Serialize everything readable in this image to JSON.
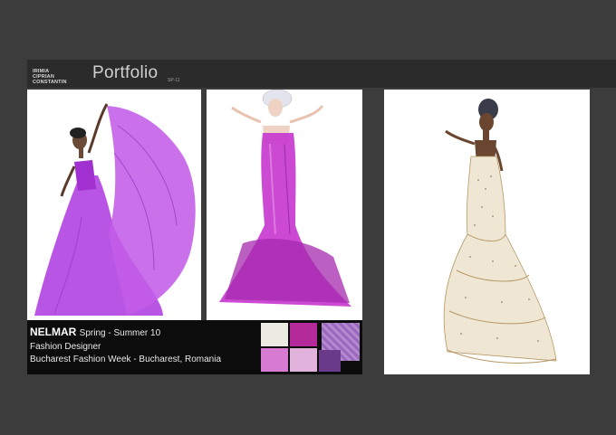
{
  "header": {
    "author_lines": [
      "IRIMIA",
      "CIPRIAN",
      "CONSTANTIN"
    ],
    "title": "Portfolio",
    "year": "SP-11"
  },
  "caption": {
    "brand": "NELMAR",
    "season": "Spring - Summer 10",
    "role": "Fashion Designer",
    "event": "Bucharest Fashion Week - Bucharest, Romania"
  },
  "colors": {
    "background": "#3c3c3c",
    "header_band": "#2b2b2b",
    "caption_band": "#0c0c0c",
    "gown_violet": "#b040e0",
    "gown_magenta": "#c030c8",
    "gown_ivory": "#efe6d4"
  },
  "swatches": [
    {
      "name": "ivory",
      "color": "#ecebe2"
    },
    {
      "name": "magenta",
      "color": "#b42a9a"
    },
    {
      "name": "lilac-texture",
      "color": "#a070c0"
    },
    {
      "name": "pink",
      "color": "#d67ad2"
    },
    {
      "name": "pale-rose",
      "color": "#e0b2dc"
    },
    {
      "name": "deep-purple",
      "color": "#6a3a8a"
    }
  ],
  "illustrations": [
    {
      "name": "violet-flowing-gown-sketch"
    },
    {
      "name": "magenta-mermaid-gown-sketch"
    },
    {
      "name": "ivory-embellished-gown-sketch"
    }
  ]
}
